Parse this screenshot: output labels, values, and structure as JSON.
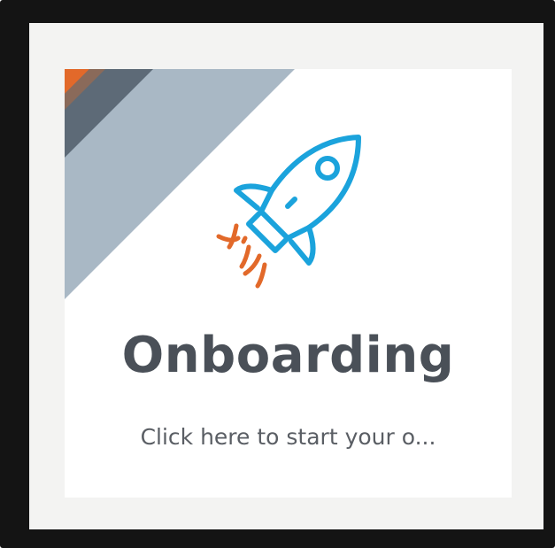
{
  "tile": {
    "title": "Onboarding",
    "description": "Click here to start your o...",
    "icon": "rocket-icon"
  },
  "colors": {
    "accent_orange": "#e2692a",
    "band_dark": "#5d6a77",
    "band_light": "#a9b8c5",
    "icon_blue": "#1ba3dc",
    "title_gray": "#4a5058"
  }
}
